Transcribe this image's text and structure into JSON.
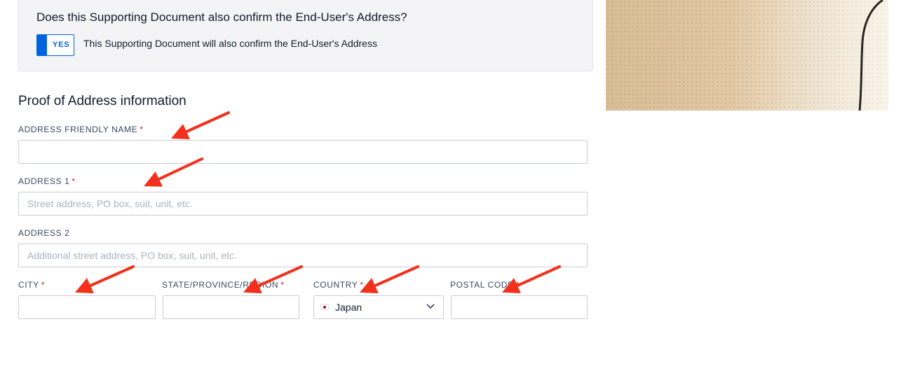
{
  "confirm": {
    "question": "Does this Supporting Document also confirm the End-User's Address?",
    "toggle_label": "YES",
    "toggle_description": "This Supporting Document will also confirm the End-User's Address"
  },
  "section_title": "Proof of Address information",
  "fields": {
    "friendly_name": {
      "label": "ADDRESS FRIENDLY NAME",
      "required": "*",
      "value": "",
      "placeholder": ""
    },
    "address1": {
      "label": "ADDRESS 1",
      "required": "*",
      "value": "",
      "placeholder": "Street address, PO box, suit, unit, etc."
    },
    "address2": {
      "label": "ADDRESS 2",
      "value": "",
      "placeholder": "Additional street address, PO box, suit, unit, etc."
    },
    "city": {
      "label": "CITY",
      "required": "*",
      "value": ""
    },
    "state": {
      "label": "STATE/PROVINCE/REGION",
      "required": "*",
      "value": ""
    },
    "country": {
      "label": "COUNTRY",
      "required": "*",
      "selected": "Japan",
      "flag_icon": "japan-flag-icon"
    },
    "postal": {
      "label": "POSTAL CODE",
      "required": "*",
      "value": ""
    }
  },
  "colors": {
    "accent": "#0263e0",
    "required": "#d61f1f",
    "annotation_arrow": "#f2301b"
  }
}
